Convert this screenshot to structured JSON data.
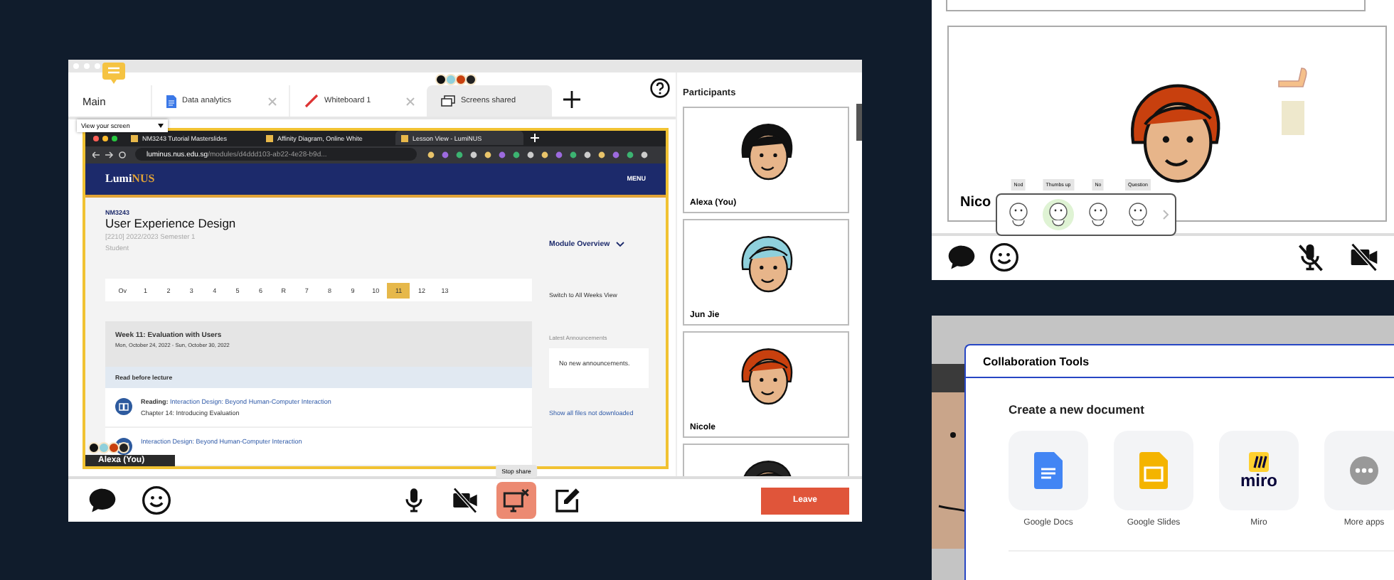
{
  "main_window": {
    "tabs": [
      {
        "label": "Main",
        "kind": "main",
        "selected": false
      },
      {
        "label": "Data analytics",
        "kind": "document",
        "selected": false
      },
      {
        "label": "Whiteboard 1",
        "kind": "whiteboard",
        "selected": false
      },
      {
        "label": "Screens shared",
        "kind": "screens",
        "selected": true
      }
    ],
    "view_selector": {
      "label": "View your screen"
    },
    "shared_screen": {
      "browser_tabs": [
        {
          "title": "NM3243 Tutorial Masterslides",
          "selected": false
        },
        {
          "title": "Affinity Diagram, Online White",
          "selected": false
        },
        {
          "title": "Lesson View - LumiNUS",
          "selected": true
        }
      ],
      "url_host": "luminus.nus.edu.sg",
      "url_path": "/modules/d4ddd103-ab22-4e28-b9d...",
      "site_logo": [
        "Lumi",
        "NUS"
      ],
      "menu_label": "MENU",
      "course_code": "NM3243",
      "course_title": "User Experience Design",
      "term": "[2210] 2022/2023 Semester 1",
      "role": "Student",
      "overview_label": "Module Overview",
      "weeks": [
        {
          "label": "Ov",
          "selected": false
        },
        {
          "label": "1",
          "selected": false
        },
        {
          "label": "2",
          "selected": false
        },
        {
          "label": "3",
          "selected": false
        },
        {
          "label": "4",
          "selected": false
        },
        {
          "label": "5",
          "selected": false
        },
        {
          "label": "6",
          "selected": false
        },
        {
          "label": "R",
          "selected": false
        },
        {
          "label": "7",
          "selected": false
        },
        {
          "label": "8",
          "selected": false
        },
        {
          "label": "9",
          "selected": false
        },
        {
          "label": "10",
          "selected": false
        },
        {
          "label": "11",
          "selected": true
        },
        {
          "label": "12",
          "selected": false
        },
        {
          "label": "13",
          "selected": false
        }
      ],
      "switch_view": "Switch to All Weeks View",
      "week_title": "Week 11: Evaluation with Users",
      "week_dates": "Mon, October 24, 2022 - Sun, October 30, 2022",
      "section": "Read before lecture",
      "readings": [
        {
          "label": "Reading:",
          "link": "Interaction Design: Beyond Human-Computer Interaction",
          "detail": "Chapter 14: Introducing Evaluation"
        },
        {
          "link": "Interaction Design: Beyond Human-Computer Interaction"
        }
      ],
      "announcements_title": "Latest Announcements",
      "announcements_text": "No new announcements.",
      "files_link": "Show all files not downloaded",
      "presenter": "Alexa (You)"
    },
    "participants": {
      "title": "Participants",
      "items": [
        {
          "name": "Alexa (You)",
          "color": "#111111"
        },
        {
          "name": "Jun Jie",
          "color": "#8fd0dc"
        },
        {
          "name": "Nicole",
          "color": "#c8400e"
        },
        {
          "color": "#222222"
        }
      ]
    },
    "toolbar": [
      {
        "kind": "chat",
        "active": false
      },
      {
        "kind": "emoji",
        "active": false
      },
      {
        "kind": "mic",
        "active": false
      },
      {
        "kind": "camera-off",
        "active": false
      },
      {
        "kind": "share",
        "active": true,
        "tooltip": "Stop share"
      },
      {
        "kind": "edit",
        "active": false
      }
    ],
    "leave_button": "Leave"
  },
  "video_panel": {
    "name": "Nico",
    "reactions": [
      {
        "label": "Nod",
        "selected": false
      },
      {
        "label": "Thumbs up",
        "selected": true
      },
      {
        "label": "No",
        "selected": false
      },
      {
        "label": "Question",
        "selected": false
      }
    ],
    "toolbar": [
      {
        "kind": "chat"
      },
      {
        "kind": "emoji"
      },
      {
        "kind": "mic-off"
      },
      {
        "kind": "camera-off"
      }
    ]
  },
  "collab_dialog": {
    "title": "Collaboration Tools",
    "heading": "Create a new document",
    "apps": [
      {
        "kind": "docs",
        "label": "Google Docs"
      },
      {
        "kind": "slides",
        "label": "Google Slides"
      },
      {
        "kind": "miro",
        "label": "Miro",
        "logo_text": "miro"
      },
      {
        "kind": "more",
        "label": "More apps"
      }
    ]
  }
}
